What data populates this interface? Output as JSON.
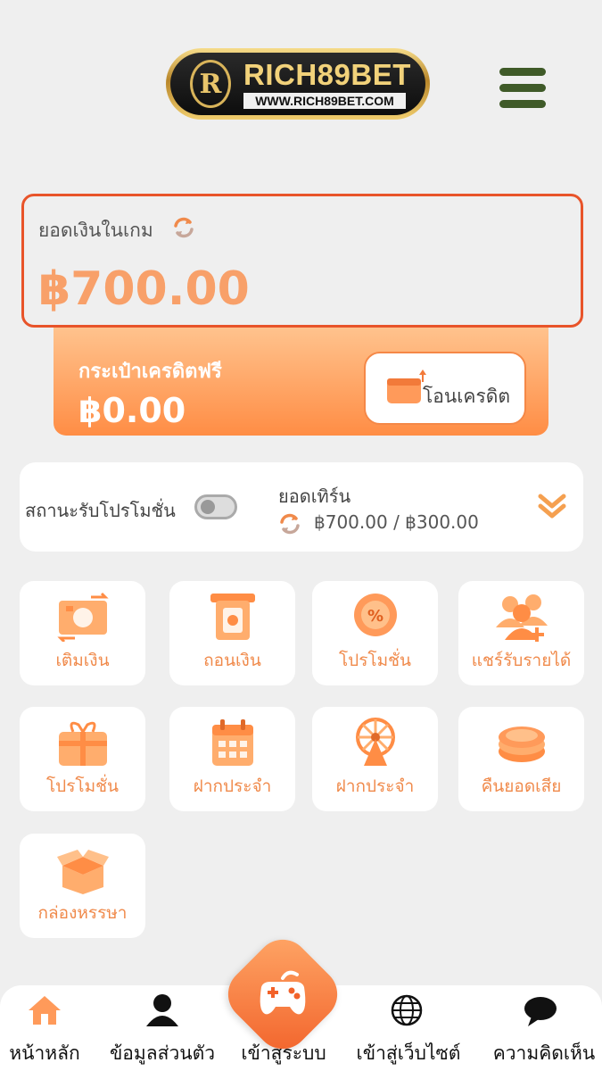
{
  "header": {
    "logo_name": "RICH89BET",
    "logo_url": "WWW.RICH89BET.COM",
    "logo_emblem": "R",
    "menu_icon": "hamburger-icon"
  },
  "balance": {
    "label": "ยอดเงินในเกม",
    "value": "฿700.00",
    "refresh_icon": "refresh-icon"
  },
  "credit_wallet": {
    "label": "กระเป๋าเครดิตฟรี",
    "value": "฿0.00",
    "transfer_label": "โอนเครดิต",
    "transfer_icon": "wallet-transfer-icon"
  },
  "status": {
    "promo_label": "สถานะรับโปรโมชั่น",
    "promo_enabled": false,
    "turnover_label": "ยอดเทิร์น",
    "turnover_value": "฿700.00 / ฿300.00"
  },
  "tiles": [
    {
      "label": "เติมเงิน",
      "icon": "deposit-icon"
    },
    {
      "label": "ถอนเงิน",
      "icon": "withdraw-icon"
    },
    {
      "label": "โปรโมชั่น",
      "icon": "promotion-badge-icon"
    },
    {
      "label": "แชร์รับรายได้",
      "icon": "share-income-icon"
    },
    {
      "label": "โปรโมชั่น",
      "icon": "gift-card-icon"
    },
    {
      "label": "ฝากประจำ",
      "icon": "calendar-icon"
    },
    {
      "label": "ฝากประจำ",
      "icon": "wheel-icon"
    },
    {
      "label": "คืนยอดเสีย",
      "icon": "coins-icon"
    },
    {
      "label": "กล่องหรรษา",
      "icon": "mystery-box-icon"
    }
  ],
  "bottom_nav": [
    {
      "label": "หน้าหลัก",
      "icon": "home-icon"
    },
    {
      "label": "ข้อมูลส่วนตัว",
      "icon": "user-icon"
    },
    {
      "label": "เข้าสู่ระบบ",
      "icon": "gamepad-icon"
    },
    {
      "label": "เข้าสู่เว็บไซต์",
      "icon": "globe-icon"
    },
    {
      "label": "ความคิดเห็น",
      "icon": "chat-bubble-icon"
    }
  ],
  "colors": {
    "accent": "#f58847",
    "border_red": "#e8542a",
    "menu_green": "#3f5a28"
  }
}
